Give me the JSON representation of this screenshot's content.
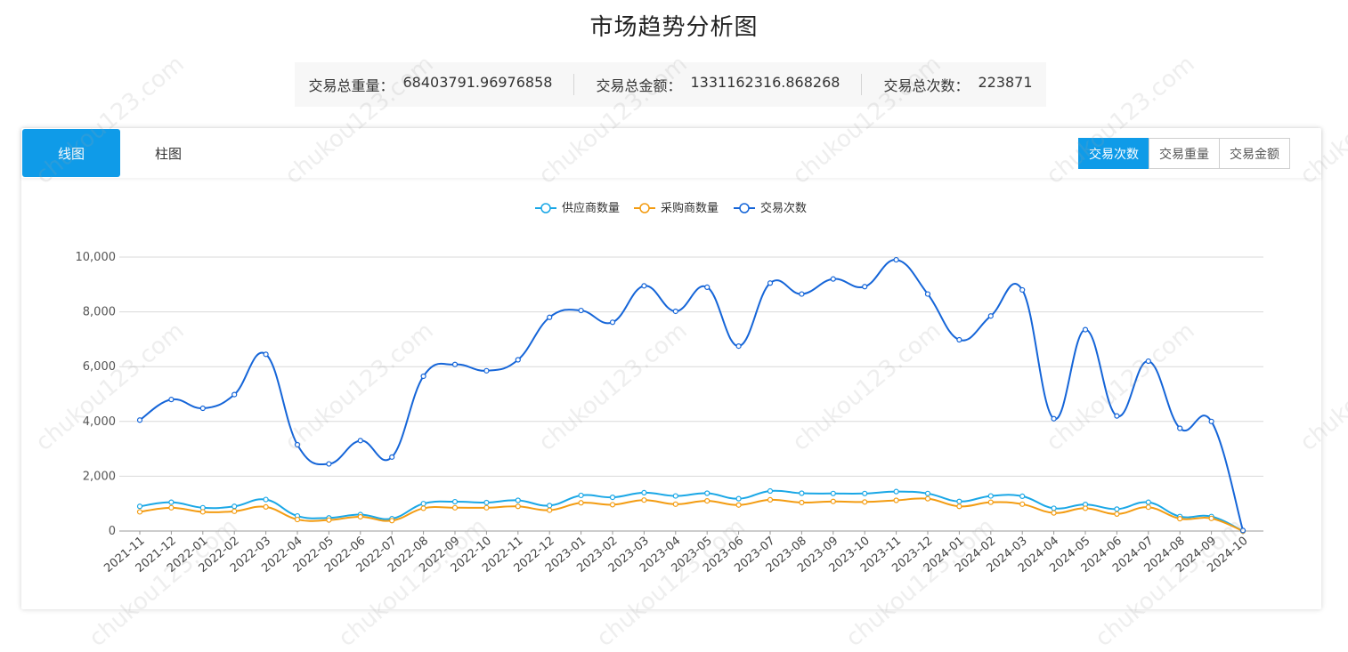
{
  "page": {
    "title": "市场趋势分析图"
  },
  "stats": [
    {
      "label": "交易总重量：",
      "value": "68403791.96976858"
    },
    {
      "label": "交易总金额：",
      "value": "1331162316.868268"
    },
    {
      "label": "交易总次数：",
      "value": "223871"
    }
  ],
  "view_tabs": [
    "线图",
    "柱图"
  ],
  "metric_buttons": [
    "交易次数",
    "交易重量",
    "交易金额"
  ],
  "watermark": "chukou123.com",
  "colors": {
    "accent": "#0f9be8",
    "supplier": "#1aa7e6",
    "buyer": "#f39c12",
    "trades": "#1565d8"
  },
  "chart_data": {
    "type": "line",
    "smooth": true,
    "legend_position": "top-center",
    "grid": true,
    "ylim": [
      0,
      10000
    ],
    "yticks": [
      0,
      2000,
      4000,
      6000,
      8000,
      10000
    ],
    "ytick_labels": [
      "0",
      "2,000",
      "4,000",
      "6,000",
      "8,000",
      "10,000"
    ],
    "categories": [
      "2021-11",
      "2021-12",
      "2022-01",
      "2022-02",
      "2022-03",
      "2022-04",
      "2022-05",
      "2022-06",
      "2022-07",
      "2022-08",
      "2022-09",
      "2022-10",
      "2022-11",
      "2022-12",
      "2023-01",
      "2023-02",
      "2023-03",
      "2023-04",
      "2023-05",
      "2023-06",
      "2023-07",
      "2023-08",
      "2023-09",
      "2023-10",
      "2023-11",
      "2023-12",
      "2024-01",
      "2024-02",
      "2024-03",
      "2024-04",
      "2024-05",
      "2024-06",
      "2024-07",
      "2024-08",
      "2024-09",
      "2024-10"
    ],
    "series": [
      {
        "name": "供应商数量",
        "color": "#1aa7e6",
        "values": [
          900,
          1050,
          850,
          900,
          1150,
          550,
          480,
          600,
          450,
          1000,
          1070,
          1040,
          1120,
          930,
          1300,
          1230,
          1400,
          1280,
          1380,
          1180,
          1460,
          1380,
          1370,
          1370,
          1440,
          1370,
          1080,
          1280,
          1270,
          830,
          970,
          800,
          1050,
          530,
          530,
          0
        ]
      },
      {
        "name": "采购商数量",
        "color": "#f39c12",
        "values": [
          700,
          850,
          700,
          720,
          880,
          420,
          400,
          520,
          380,
          830,
          850,
          850,
          900,
          760,
          1030,
          960,
          1130,
          980,
          1100,
          950,
          1140,
          1040,
          1080,
          1060,
          1120,
          1180,
          900,
          1050,
          980,
          660,
          830,
          620,
          870,
          450,
          460,
          0
        ]
      },
      {
        "name": "交易次数",
        "color": "#1565d8",
        "values": [
          4050,
          4800,
          4480,
          4980,
          6450,
          3150,
          2450,
          3300,
          2700,
          5650,
          6080,
          5850,
          6250,
          7800,
          8050,
          7620,
          8950,
          8020,
          8900,
          6750,
          9050,
          8650,
          9200,
          8920,
          9900,
          8650,
          6980,
          7850,
          8800,
          4100,
          7350,
          4200,
          6200,
          3750,
          4000,
          20
        ]
      }
    ]
  }
}
